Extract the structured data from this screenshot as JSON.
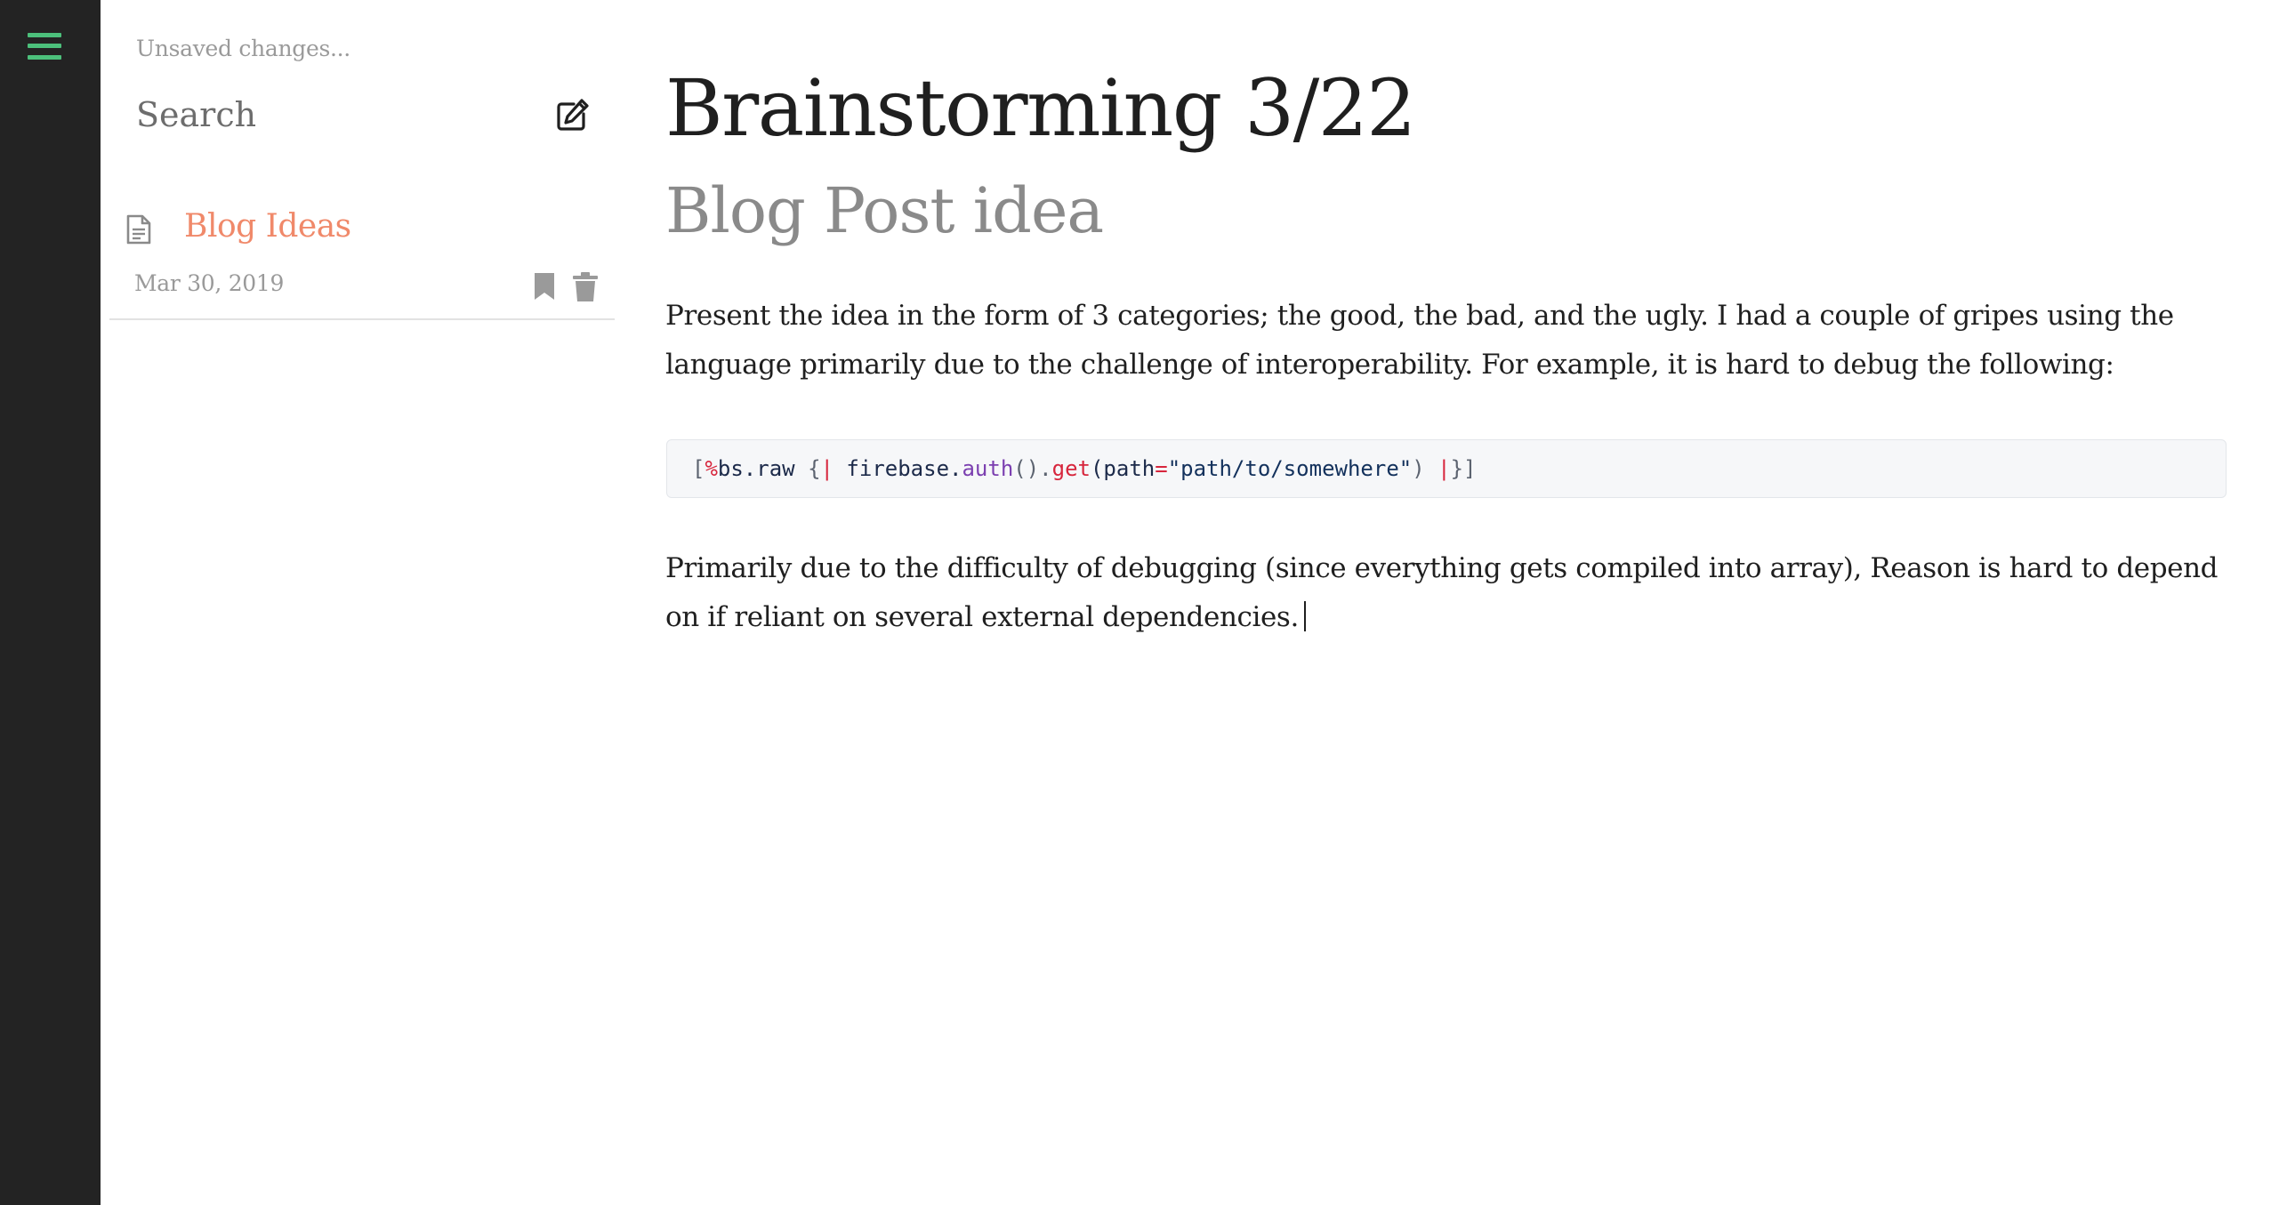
{
  "rail": {
    "menu_icon": "hamburger-menu-icon",
    "accent_color": "#4cc07b"
  },
  "notes_panel": {
    "save_status": "Unsaved changes...",
    "search_placeholder": "Search",
    "new_note_icon": "edit-icon",
    "notes": [
      {
        "title": "Blog Ideas",
        "date": "Mar 30, 2019",
        "icon": "document-icon"
      }
    ]
  },
  "editor": {
    "title": "Brainstorming 3/22",
    "subtitle": "Blog Post idea",
    "paragraph_1": "Present the idea in the form of 3 categories; the good, the bad, and the ugly. I had a couple of gripes using the language primarily due to the challenge of interoperability. For example, it is hard to debug the following:",
    "code": {
      "t1": "[",
      "t2": "%",
      "t3": "bs.raw ",
      "t4": "{",
      "t5": "|",
      "t6": " firebase.",
      "t7": "auth",
      "t8": "().",
      "t9": "get",
      "t10": "(path",
      "t11": "=",
      "t12": "\"path/to/somewhere\"",
      "t13": ") ",
      "t14": "|",
      "t15": "}]"
    },
    "paragraph_2": "Primarily due to the difficulty of debugging (since everything gets compiled into array), Reason is hard to depend on if reliant on several external dependencies."
  }
}
